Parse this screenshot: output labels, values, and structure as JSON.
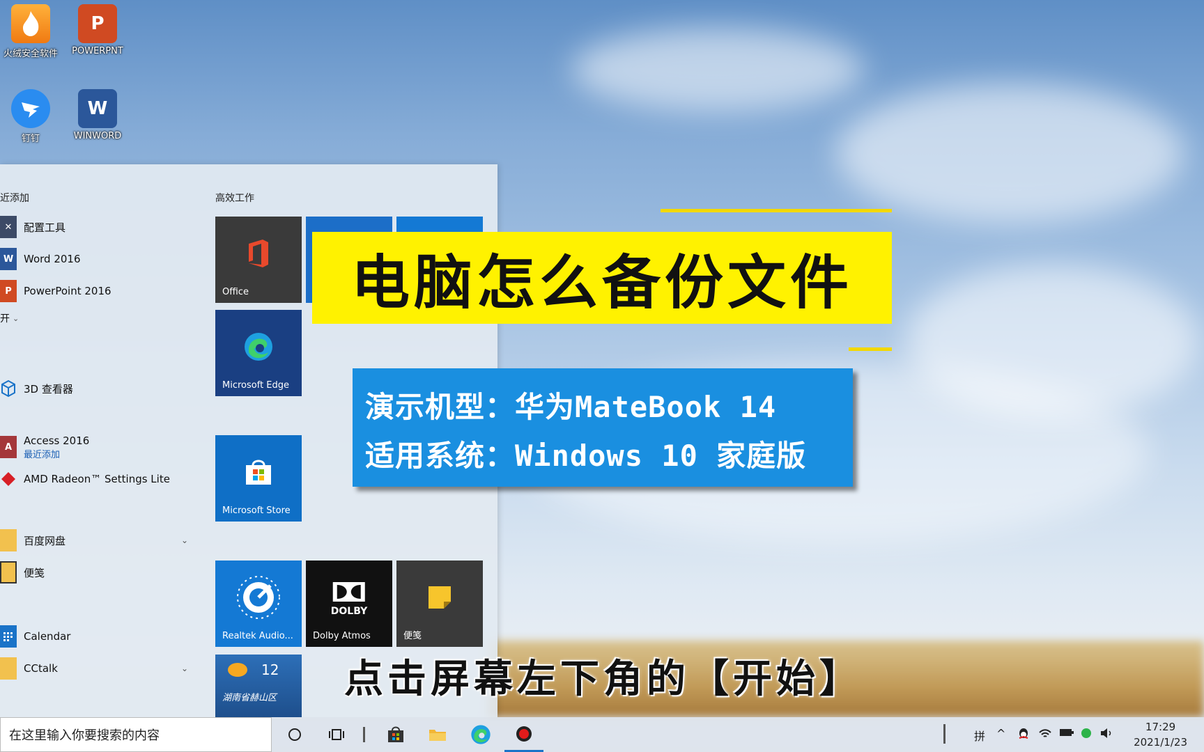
{
  "desktop": {
    "icons": [
      {
        "label": "火绒安全软件",
        "icon": "flame-shield-icon"
      },
      {
        "label": "POWERPNT",
        "icon": "powerpoint-icon"
      },
      {
        "label": "钉钉",
        "icon": "dingtalk-icon"
      },
      {
        "label": "WINWORD",
        "icon": "word-icon"
      }
    ]
  },
  "start_menu": {
    "recent_header": "近添加",
    "recent_items": [
      {
        "label": "配置工具",
        "icon": "config-tool-icon"
      },
      {
        "label": "Word 2016",
        "icon": "word-icon"
      },
      {
        "label": "PowerPoint 2016",
        "icon": "powerpoint-icon"
      }
    ],
    "expand_label": "开",
    "apps": [
      {
        "label": "3D 查看器",
        "icon": "3d-viewer-icon"
      },
      {
        "label": "Access 2016",
        "sub": "最近添加",
        "icon": "access-icon"
      },
      {
        "label": "AMD Radeon™ Settings Lite",
        "icon": "amd-icon"
      },
      {
        "label": "百度网盘",
        "icon": "folder-icon"
      },
      {
        "label": "便笺",
        "icon": "sticky-notes-icon"
      },
      {
        "label": "Calendar",
        "icon": "calendar-icon"
      },
      {
        "label": "CCtalk",
        "icon": "folder-icon"
      }
    ],
    "tiles_header": "高效工作",
    "tiles": [
      {
        "label": "Office",
        "icon": "office-icon"
      },
      {
        "label": "Microsoft Edge",
        "icon": "edge-icon"
      },
      {
        "label": "Microsoft Store",
        "icon": "store-icon"
      },
      {
        "label": "Realtek Audio...",
        "icon": "realtek-audio-icon"
      },
      {
        "label": "Dolby Atmos",
        "icon": "dolby-icon",
        "logo_text": "DOLBY"
      },
      {
        "label": "便笺",
        "icon": "sticky-notes-icon"
      },
      {
        "label": "湖南省赫山区",
        "icon": "weather-icon",
        "temp": "12"
      }
    ]
  },
  "overlay": {
    "title": "电脑怎么备份文件",
    "device_line": "演示机型：华为MateBook 14",
    "system_line": "适用系统：Windows 10 家庭版",
    "subtitle": "点击屏幕左下角的【开始】"
  },
  "taskbar": {
    "search_placeholder": "在这里输入你要搜索的内容",
    "ime": "拼",
    "time": "17:29",
    "date": "2021/1/23"
  },
  "colors": {
    "title_banner": "#fff200",
    "device_box": "#1a8fe0",
    "tile_blue": "#0f6fc6",
    "tile_dark": "#3a3a3a"
  }
}
